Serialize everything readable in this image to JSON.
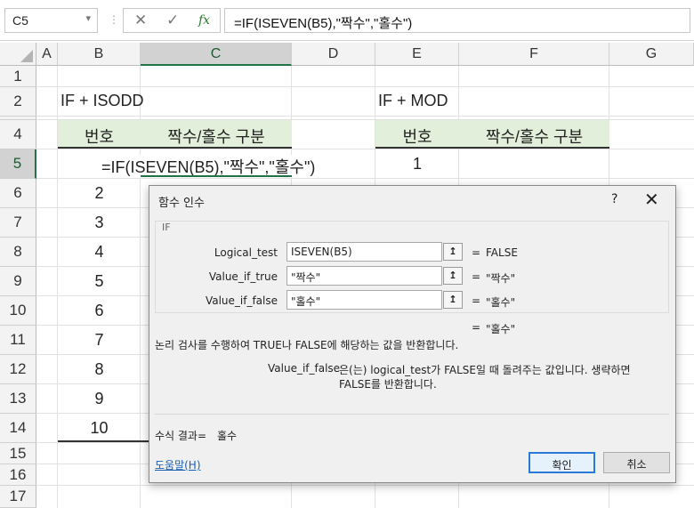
{
  "formula_bar": {
    "name_box": "C5",
    "cancel_icon": "✕",
    "enter_icon": "✓",
    "fx_label": "fx",
    "formula": "=IF(ISEVEN(B5),\"짝수\",\"홀수\")"
  },
  "columns": [
    "A",
    "B",
    "C",
    "D",
    "E",
    "F",
    "G"
  ],
  "rows": [
    "1",
    "2",
    "4",
    "5",
    "6",
    "7",
    "8",
    "9",
    "10",
    "11",
    "12",
    "13",
    "14",
    "15",
    "16",
    "17"
  ],
  "cells": {
    "B2": "IF +  ISODD",
    "E2": "IF + MOD",
    "B4": "번호",
    "C4": "짝수/홀수 구분",
    "E4": "번호",
    "F4": "짝수/홀수 구분",
    "C5": "=IF(ISEVEN(B5),\"짝수\",\"홀수\")",
    "E5": "1",
    "B6": "2",
    "B7": "3",
    "B8": "4",
    "B9": "5",
    "B10": "6",
    "B11": "7",
    "B12": "8",
    "B13": "9",
    "B14": "10"
  },
  "dialog": {
    "title": "함수 인수",
    "help_glyph": "?",
    "close_glyph": "✕",
    "function_name": "IF",
    "args": [
      {
        "label": "Logical_test",
        "value": "ISEVEN(B5)",
        "result": "FALSE"
      },
      {
        "label": "Value_if_true",
        "value": "\"짝수\"",
        "result": "\"짝수\""
      },
      {
        "label": "Value_if_false",
        "value": "\"홀수\"",
        "result": "\"홀수\""
      }
    ],
    "collapse_glyph": "↥",
    "eq": "=",
    "overall_result": "\"홀수\"",
    "description": "논리 검사를 수행하여 TRUE나 FALSE에 해당하는 값을 반환합니다.",
    "arg_help_name": "Value_if_false",
    "arg_help_line1": "은(는) logical_test가 FALSE일 때 돌려주는 값입니다. 생략하면",
    "arg_help_line2": "FALSE를 반환합니다.",
    "formula_result_label": "수식 결과=",
    "formula_result_value": "홀수",
    "help_link": "도움말(H)",
    "ok": "확인",
    "cancel": "취소"
  }
}
